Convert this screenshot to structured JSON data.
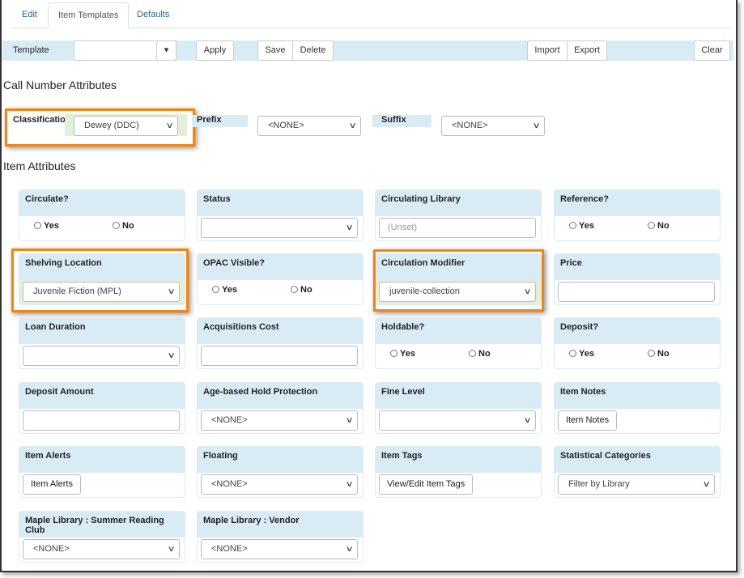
{
  "tabs": [
    {
      "label": "Edit",
      "active": false
    },
    {
      "label": "Item Templates",
      "active": true
    },
    {
      "label": "Defaults",
      "active": false
    }
  ],
  "toolbar": {
    "template_label": "Template",
    "template_value": "",
    "apply": "Apply",
    "save": "Save",
    "delete": "Delete",
    "import": "Import",
    "export": "Export",
    "clear": "Clear"
  },
  "call_number": {
    "title": "Call Number Attributes",
    "classification_label": "Classification",
    "classification_value": "Dewey (DDC)",
    "prefix_label": "Prefix",
    "prefix_value": "<NONE>",
    "suffix_label": "Suffix",
    "suffix_value": "<NONE>"
  },
  "item_attributes": {
    "title": "Item Attributes",
    "cards": [
      {
        "label": "Circulate?",
        "type": "radio",
        "options": [
          "Yes",
          "No"
        ]
      },
      {
        "label": "Status",
        "type": "select",
        "value": ""
      },
      {
        "label": "Circulating Library",
        "type": "input",
        "placeholder": "(Unset)"
      },
      {
        "label": "Reference?",
        "type": "radio",
        "options": [
          "Yes",
          "No"
        ]
      },
      {
        "label": "Shelving Location",
        "type": "select",
        "value": "Juvenile Fiction (MPL)",
        "highlight": true
      },
      {
        "label": "OPAC Visible?",
        "type": "radio",
        "options": [
          "Yes",
          "No"
        ]
      },
      {
        "label": "Circulation Modifier",
        "type": "select",
        "value": "juvenile-collection",
        "highlight": true
      },
      {
        "label": "Price",
        "type": "input",
        "placeholder": ""
      },
      {
        "label": "Loan Duration",
        "type": "select",
        "value": ""
      },
      {
        "label": "Acquisitions Cost",
        "type": "input",
        "placeholder": ""
      },
      {
        "label": "Holdable?",
        "type": "radio",
        "options": [
          "Yes",
          "No"
        ]
      },
      {
        "label": "Deposit?",
        "type": "radio",
        "options": [
          "Yes",
          "No"
        ]
      },
      {
        "label": "Deposit Amount",
        "type": "input",
        "placeholder": ""
      },
      {
        "label": "Age-based Hold Protection",
        "type": "select",
        "value": "<NONE>"
      },
      {
        "label": "Fine Level",
        "type": "select",
        "value": ""
      },
      {
        "label": "Item Notes",
        "type": "button",
        "button": "Item Notes"
      },
      {
        "label": "Item Alerts",
        "type": "button",
        "button": "Item Alerts"
      },
      {
        "label": "Floating",
        "type": "select",
        "value": "<NONE>"
      },
      {
        "label": "Item Tags",
        "type": "button",
        "button": "View/Edit Item Tags"
      },
      {
        "label": "Statistical Categories",
        "type": "select",
        "value": "Filter by Library"
      },
      {
        "label": "Maple Library : Summer Reading Club",
        "type": "select",
        "value": "<NONE>"
      },
      {
        "label": "Maple Library : Vendor",
        "type": "select",
        "value": "<NONE>"
      }
    ]
  },
  "colors": {
    "panel": "#d9ecf5",
    "highlight": "#f5840c",
    "changed": "#e2f0da",
    "link": "#2a6496"
  }
}
